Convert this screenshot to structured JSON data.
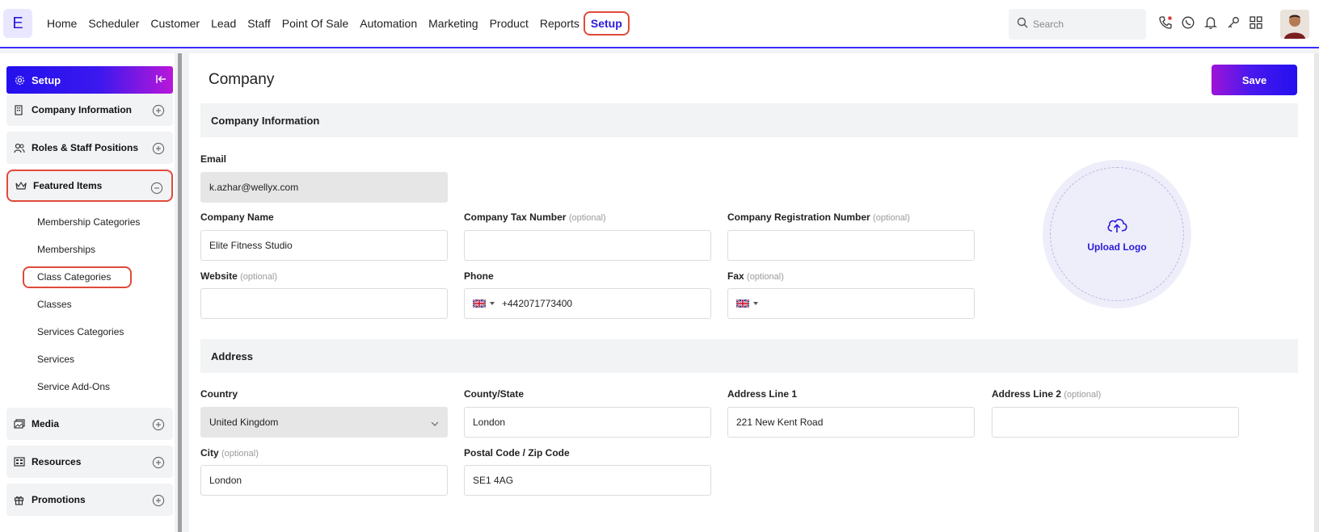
{
  "brand": {
    "logo_letter": "E",
    "accent": "#2b1ad9",
    "highlight": "#e04a3a"
  },
  "nav": {
    "items": [
      "Home",
      "Scheduler",
      "Customer",
      "Lead",
      "Staff",
      "Point Of Sale",
      "Automation",
      "Marketing",
      "Product",
      "Reports"
    ],
    "active": "Setup"
  },
  "search": {
    "placeholder": "Search"
  },
  "top_icons": [
    "phone-icon",
    "whatsapp-icon",
    "bell-icon",
    "key-icon",
    "apps-grid-icon"
  ],
  "sidebar": {
    "title": "Setup",
    "groups": [
      {
        "label": "Company Information",
        "icon": "building-icon",
        "expanded": false
      },
      {
        "label": "Roles & Staff Positions",
        "icon": "users-icon",
        "expanded": false
      },
      {
        "label": "Featured Items",
        "icon": "crown-icon",
        "expanded": true
      }
    ],
    "featured_items": [
      "Membership Categories",
      "Memberships",
      "Class Categories",
      "Classes",
      "Services Categories",
      "Services",
      "Service Add-Ons"
    ],
    "highlighted_subitem": "Class Categories",
    "bottom_groups": [
      {
        "label": "Media",
        "icon": "media-icon"
      },
      {
        "label": "Resources",
        "icon": "resources-icon"
      },
      {
        "label": "Promotions",
        "icon": "gift-icon"
      }
    ]
  },
  "page": {
    "title": "Company",
    "save_label": "Save"
  },
  "company_section": {
    "title": "Company Information",
    "email_label": "Email",
    "email_value": "k.azhar@wellyx.com",
    "company_name_label": "Company Name",
    "company_name_value": "Elite  Fitness Studio",
    "tax_label": "Company Tax Number",
    "tax_value": "",
    "reg_label": "Company Registration Number",
    "reg_value": "",
    "optional": "(optional)",
    "website_label": "Website",
    "website_value": "",
    "phone_label": "Phone",
    "phone_value": "+442071773400",
    "fax_label": "Fax",
    "fax_value": "",
    "upload_label": "Upload Logo"
  },
  "address_section": {
    "title": "Address",
    "country_label": "Country",
    "country_value": "United Kingdom",
    "county_label": "County/State",
    "county_value": "London",
    "line1_label": "Address Line 1",
    "line1_value": "221 New Kent Road",
    "line2_label": "Address Line 2",
    "line2_value": "",
    "city_label": "City",
    "city_value": "London",
    "postal_label": "Postal Code / Zip Code",
    "postal_value": "SE1 4AG"
  }
}
